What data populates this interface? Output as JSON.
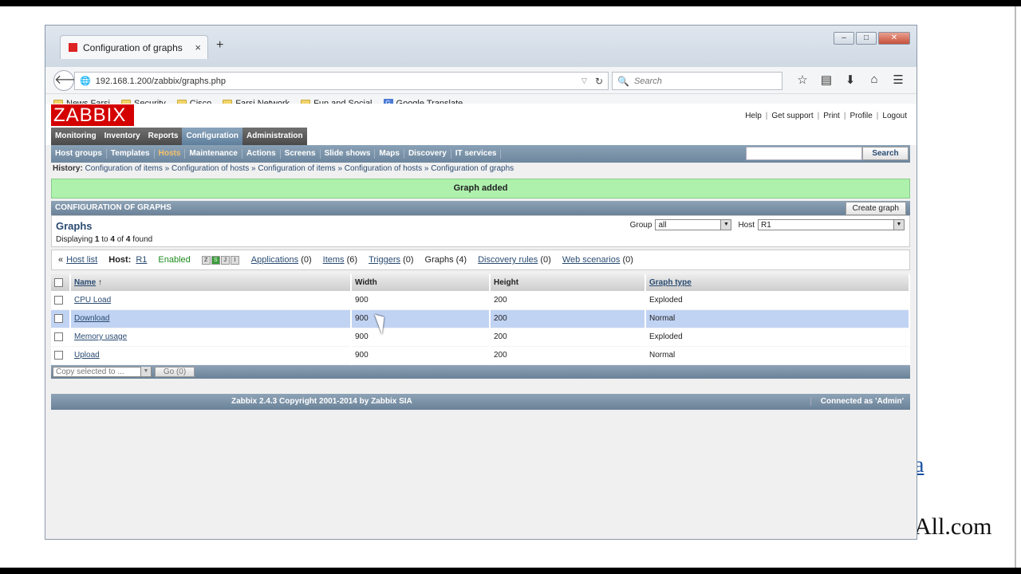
{
  "browser": {
    "tab_title": "Configuration of graphs",
    "tab_close": "×",
    "new_tab": "+",
    "url": "192.168.1.200/zabbix/graphs.php",
    "search_placeholder": "Search",
    "bookmarks": [
      "News Farsi",
      "Security",
      "Cisco",
      "Farsi Network",
      "Fun and Social",
      "Google Translate"
    ]
  },
  "zabbix": {
    "logo": "ZABBIX",
    "toplinks": [
      "Help",
      "Get support",
      "Print",
      "Profile",
      "Logout"
    ],
    "main_menu": [
      "Monitoring",
      "Inventory",
      "Reports",
      "Configuration",
      "Administration"
    ],
    "main_menu_active": "Configuration",
    "sub_menu": [
      "Host groups",
      "Templates",
      "Hosts",
      "Maintenance",
      "Actions",
      "Screens",
      "Slide shows",
      "Maps",
      "Discovery",
      "IT services"
    ],
    "sub_menu_active": "Hosts",
    "search_button": "Search",
    "history_label": "History:",
    "history": [
      "Configuration of items",
      "Configuration of hosts",
      "Configuration of items",
      "Configuration of hosts",
      "Configuration of graphs"
    ],
    "message": "Graph added",
    "section_title": "CONFIGURATION OF GRAPHS",
    "create_button": "Create graph",
    "graphs_title": "Graphs",
    "displaying": {
      "prefix": "Displaying",
      "from": "1",
      "to_word": "to",
      "to": "4",
      "of_word": "of",
      "total": "4",
      "suffix": "found"
    },
    "group_label": "Group",
    "group_value": "all",
    "host_label": "Host",
    "host_value": "R1",
    "hostnav": {
      "back": "«",
      "host_list": "Host list",
      "host_label": "Host:",
      "host_name": "R1",
      "status": "Enabled",
      "applications": "Applications",
      "applications_count": "(0)",
      "items": "Items",
      "items_count": "(6)",
      "triggers": "Triggers",
      "triggers_count": "(0)",
      "graphs": "Graphs",
      "graphs_count": "(4)",
      "discovery": "Discovery rules",
      "discovery_count": "(0)",
      "web": "Web scenarios",
      "web_count": "(0)"
    },
    "table": {
      "headers": [
        "Name",
        "Width",
        "Height",
        "Graph type"
      ],
      "rows": [
        [
          "CPU Load",
          "900",
          "200",
          "Exploded"
        ],
        [
          "Download",
          "900",
          "200",
          "Normal"
        ],
        [
          "Memory usage",
          "900",
          "200",
          "Exploded"
        ],
        [
          "Upload",
          "900",
          "200",
          "Normal"
        ]
      ]
    },
    "action_select": "Copy selected to ...",
    "go_button": "Go (0)",
    "copyright": "Zabbix 2.4.3 Copyright 2001-2014 by Zabbix SIA",
    "connected": "Connected as 'Admin'"
  },
  "overlay": {
    "a": "a",
    "com": "All.com"
  }
}
